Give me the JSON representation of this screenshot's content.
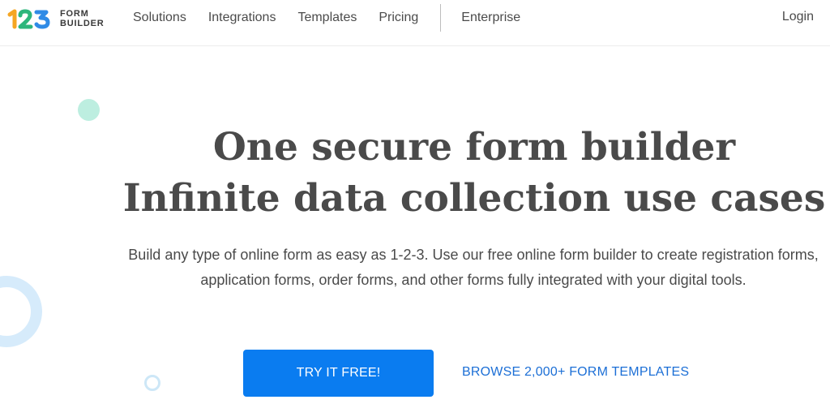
{
  "brand": {
    "logo_digits": "123",
    "logo_line1": "FORM",
    "logo_line2": "BUILDER",
    "colors": {
      "digit_1": "#f5a623",
      "digit_2": "#2db67c",
      "digit_3": "#2f8be6"
    }
  },
  "nav": {
    "items": [
      {
        "label": "Solutions"
      },
      {
        "label": "Integrations"
      },
      {
        "label": "Templates"
      },
      {
        "label": "Pricing"
      },
      {
        "label": "Enterprise"
      }
    ],
    "login_label": "Login"
  },
  "hero": {
    "title_line1": "One secure form builder",
    "title_line2": "Infinite data collection use cases",
    "subtitle": "Build any type of online form as easy as 1-2-3. Use our free online form builder to create registration forms, application forms, order forms, and other forms fully integrated with your digital tools.",
    "cta_label": "TRY IT FREE!",
    "browse_label": "BROWSE 2,000+ FORM TEMPLATES"
  },
  "theme": {
    "accent": "#0a7cf0",
    "link": "#1c6fd6",
    "text": "#4a4a4a"
  }
}
